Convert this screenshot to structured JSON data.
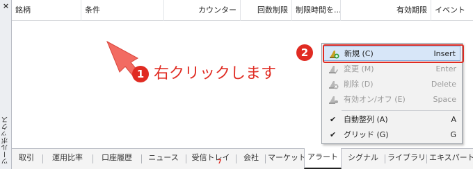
{
  "toolbox": {
    "close_glyph": "×",
    "label": "ツールボックス"
  },
  "columns": [
    {
      "label": "銘柄"
    },
    {
      "label": "条件"
    },
    {
      "label": "カウンター"
    },
    {
      "label": "回数制限"
    },
    {
      "label": "制限時間を..."
    },
    {
      "label": "有効期限"
    },
    {
      "label": "イベント"
    }
  ],
  "annotation": {
    "arrow_color": "#f26b62",
    "accent_color": "#e02b22",
    "step1_number": "1",
    "step1_text": "右クリックします",
    "step2_number": "2"
  },
  "context_menu": {
    "items": [
      {
        "label": "新規 (C)",
        "shortcut": "Insert",
        "icon": "new-alert-icon",
        "enabled": true,
        "highlighted": true
      },
      {
        "label": "変更 (M)",
        "shortcut": "Enter",
        "icon": "edit-alert-icon",
        "enabled": false
      },
      {
        "label": "削除 (D)",
        "shortcut": "Delete",
        "icon": "delete-alert-icon",
        "enabled": false
      },
      {
        "label": "有効オン/オフ (E)",
        "shortcut": "Space",
        "icon": "toggle-alert-icon",
        "enabled": false
      },
      {
        "label": "自動整列 (A)",
        "shortcut": "A",
        "checked": true,
        "enabled": true
      },
      {
        "label": "グリッド (G)",
        "shortcut": "G",
        "checked": true,
        "enabled": true
      }
    ]
  },
  "tabs": [
    {
      "label": "取引"
    },
    {
      "label": "運用比率"
    },
    {
      "label": "口座履歴"
    },
    {
      "label": "ニュース"
    },
    {
      "label": "受信トレイ",
      "badge": "7"
    },
    {
      "label": "会社"
    },
    {
      "label": "マーケット"
    },
    {
      "label": "アラート",
      "active": true
    },
    {
      "label": "シグナル"
    },
    {
      "label": "ライブラリ"
    },
    {
      "label": "エキスパート"
    }
  ]
}
